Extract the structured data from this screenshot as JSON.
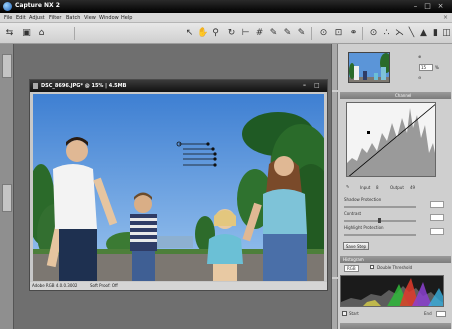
{
  "app": {
    "title": "Capture NX 2"
  },
  "menu": {
    "items": [
      "File",
      "Edit",
      "Adjust",
      "Filter",
      "Batch",
      "View",
      "Window",
      "Help"
    ]
  },
  "toolbar": {
    "icons": [
      "browser-icon",
      "open-icon",
      "save-icon",
      "arrow-select-icon",
      "hand-icon",
      "zoom-icon",
      "rotate-icon",
      "straighten-icon",
      "crop-icon",
      "eyedropper-icon",
      "black-point-icon",
      "white-point-icon",
      "neutral-point-icon",
      "red-eye-icon",
      "fit-window-icon",
      "auto-retouch-icon",
      "color-control-point-icon",
      "control-point-icon",
      "lasso-icon",
      "brush-icon",
      "fill-icon",
      "gradient-icon",
      "mask-icon"
    ]
  },
  "image_window": {
    "title": "DSC_8696.JPG* @ 15% | 4.5MB",
    "status_profile": "Adobe RGB 4.0.0.3002",
    "status_softproof": "Soft Proof: Off"
  },
  "navigator": {
    "zoom_value": "15",
    "zoom_unit": "%"
  },
  "curves": {
    "channel_label": "Channel",
    "input_label": "Input",
    "input_value": "8",
    "output_label": "Output",
    "output_value": "49"
  },
  "adjust": {
    "shadow_label": "Shadow Protection",
    "contrast_label": "Contrast",
    "highlight_label": "Highlight Protection",
    "save_button": "Save Step"
  },
  "histogram": {
    "header": "Histogram",
    "channel": "RGB",
    "double_threshold": "Double Threshold",
    "start_label": "Start",
    "end_label": "End"
  },
  "colors": {
    "sky": "#4f8fd8",
    "titlebar": "#111111",
    "panel": "#cfcfcf"
  }
}
